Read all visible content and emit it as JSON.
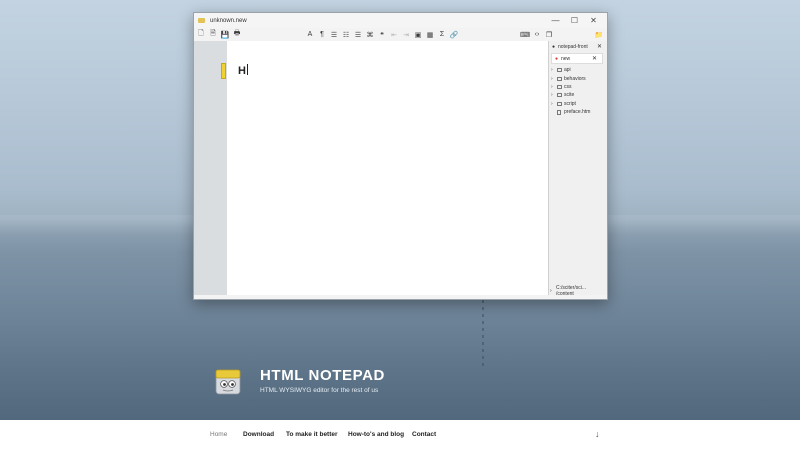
{
  "window": {
    "title": "unknown.new",
    "controls": {
      "minimize": "—",
      "maximize": "☐",
      "close": "✕"
    }
  },
  "toolbar": {
    "left": [
      {
        "name": "new-file-icon",
        "glyph": "🗋"
      },
      {
        "name": "open-file-icon",
        "glyph": "🗎"
      },
      {
        "name": "save-icon",
        "glyph": "💾"
      },
      {
        "name": "print-icon",
        "glyph": "🖶"
      }
    ],
    "mid": [
      {
        "name": "font-icon",
        "glyph": "A",
        "dim": false
      },
      {
        "name": "paragraph-icon",
        "glyph": "¶",
        "dim": false
      },
      {
        "name": "bullet-list-icon",
        "glyph": "☰",
        "dim": false
      },
      {
        "name": "numbered-list-icon",
        "glyph": "☷",
        "dim": false
      },
      {
        "name": "list-icon",
        "glyph": "☰",
        "dim": false
      },
      {
        "name": "code-block-icon",
        "glyph": "⌘",
        "dim": false
      },
      {
        "name": "quote-icon",
        "glyph": "❝",
        "dim": false
      },
      {
        "name": "outdent-icon",
        "glyph": "⇤",
        "dim": true
      },
      {
        "name": "indent-icon",
        "glyph": "⇥",
        "dim": true
      },
      {
        "name": "image-icon",
        "glyph": "▣",
        "dim": false
      },
      {
        "name": "table-icon",
        "glyph": "▦",
        "dim": false
      },
      {
        "name": "formula-icon",
        "glyph": "Σ",
        "dim": false
      },
      {
        "name": "link-icon",
        "glyph": "🔗",
        "dim": false
      }
    ],
    "right": [
      {
        "name": "keyboard-icon",
        "glyph": "⌨"
      },
      {
        "name": "source-code-icon",
        "glyph": "‹›"
      },
      {
        "name": "windows-icon",
        "glyph": "❐"
      }
    ]
  },
  "editor": {
    "content": "H"
  },
  "sidebar": {
    "folder_button": "📁",
    "tabs": [
      {
        "label": "notepad-front",
        "mark": "●",
        "close": "✕",
        "active": false
      },
      {
        "label": "new",
        "mark": "●",
        "close": "✕",
        "active": true
      }
    ],
    "tree": [
      {
        "label": "api",
        "type": "folder"
      },
      {
        "label": "behaviors",
        "type": "folder"
      },
      {
        "label": "css",
        "type": "folder"
      },
      {
        "label": "scite",
        "type": "folder"
      },
      {
        "label": "script",
        "type": "folder"
      },
      {
        "label": "preface.htm",
        "type": "file"
      }
    ],
    "path": "C:/sciter/sci... /content"
  },
  "brand": {
    "title": "HTML NOTEPAD",
    "subtitle": "HTML WYSIWYG editor for the rest of us"
  },
  "nav": {
    "items": [
      {
        "label": "Home",
        "current": true
      },
      {
        "label": "Download",
        "current": false
      },
      {
        "label": "To make it better",
        "current": false
      },
      {
        "label": "How-to's and blog",
        "current": false
      },
      {
        "label": "Contact",
        "current": false
      }
    ],
    "scroll_icon": "↓"
  }
}
